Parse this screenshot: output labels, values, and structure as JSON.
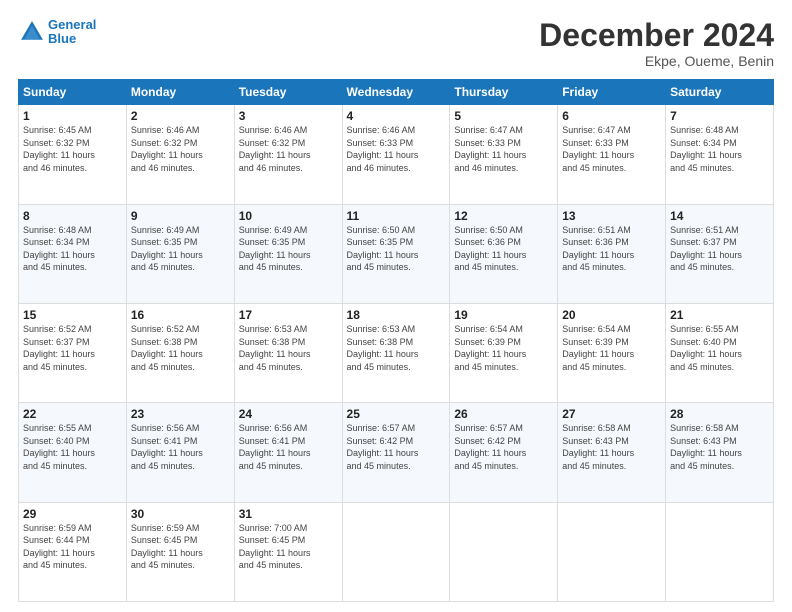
{
  "logo": {
    "line1": "General",
    "line2": "Blue"
  },
  "title": "December 2024",
  "subtitle": "Ekpe, Oueme, Benin",
  "weekdays": [
    "Sunday",
    "Monday",
    "Tuesday",
    "Wednesday",
    "Thursday",
    "Friday",
    "Saturday"
  ],
  "weeks": [
    [
      {
        "day": "1",
        "sunrise": "6:45 AM",
        "sunset": "6:32 PM",
        "daylight": "11 hours and 46 minutes."
      },
      {
        "day": "2",
        "sunrise": "6:46 AM",
        "sunset": "6:32 PM",
        "daylight": "11 hours and 46 minutes."
      },
      {
        "day": "3",
        "sunrise": "6:46 AM",
        "sunset": "6:32 PM",
        "daylight": "11 hours and 46 minutes."
      },
      {
        "day": "4",
        "sunrise": "6:46 AM",
        "sunset": "6:33 PM",
        "daylight": "11 hours and 46 minutes."
      },
      {
        "day": "5",
        "sunrise": "6:47 AM",
        "sunset": "6:33 PM",
        "daylight": "11 hours and 46 minutes."
      },
      {
        "day": "6",
        "sunrise": "6:47 AM",
        "sunset": "6:33 PM",
        "daylight": "11 hours and 45 minutes."
      },
      {
        "day": "7",
        "sunrise": "6:48 AM",
        "sunset": "6:34 PM",
        "daylight": "11 hours and 45 minutes."
      }
    ],
    [
      {
        "day": "8",
        "sunrise": "6:48 AM",
        "sunset": "6:34 PM",
        "daylight": "11 hours and 45 minutes."
      },
      {
        "day": "9",
        "sunrise": "6:49 AM",
        "sunset": "6:35 PM",
        "daylight": "11 hours and 45 minutes."
      },
      {
        "day": "10",
        "sunrise": "6:49 AM",
        "sunset": "6:35 PM",
        "daylight": "11 hours and 45 minutes."
      },
      {
        "day": "11",
        "sunrise": "6:50 AM",
        "sunset": "6:35 PM",
        "daylight": "11 hours and 45 minutes."
      },
      {
        "day": "12",
        "sunrise": "6:50 AM",
        "sunset": "6:36 PM",
        "daylight": "11 hours and 45 minutes."
      },
      {
        "day": "13",
        "sunrise": "6:51 AM",
        "sunset": "6:36 PM",
        "daylight": "11 hours and 45 minutes."
      },
      {
        "day": "14",
        "sunrise": "6:51 AM",
        "sunset": "6:37 PM",
        "daylight": "11 hours and 45 minutes."
      }
    ],
    [
      {
        "day": "15",
        "sunrise": "6:52 AM",
        "sunset": "6:37 PM",
        "daylight": "11 hours and 45 minutes."
      },
      {
        "day": "16",
        "sunrise": "6:52 AM",
        "sunset": "6:38 PM",
        "daylight": "11 hours and 45 minutes."
      },
      {
        "day": "17",
        "sunrise": "6:53 AM",
        "sunset": "6:38 PM",
        "daylight": "11 hours and 45 minutes."
      },
      {
        "day": "18",
        "sunrise": "6:53 AM",
        "sunset": "6:38 PM",
        "daylight": "11 hours and 45 minutes."
      },
      {
        "day": "19",
        "sunrise": "6:54 AM",
        "sunset": "6:39 PM",
        "daylight": "11 hours and 45 minutes."
      },
      {
        "day": "20",
        "sunrise": "6:54 AM",
        "sunset": "6:39 PM",
        "daylight": "11 hours and 45 minutes."
      },
      {
        "day": "21",
        "sunrise": "6:55 AM",
        "sunset": "6:40 PM",
        "daylight": "11 hours and 45 minutes."
      }
    ],
    [
      {
        "day": "22",
        "sunrise": "6:55 AM",
        "sunset": "6:40 PM",
        "daylight": "11 hours and 45 minutes."
      },
      {
        "day": "23",
        "sunrise": "6:56 AM",
        "sunset": "6:41 PM",
        "daylight": "11 hours and 45 minutes."
      },
      {
        "day": "24",
        "sunrise": "6:56 AM",
        "sunset": "6:41 PM",
        "daylight": "11 hours and 45 minutes."
      },
      {
        "day": "25",
        "sunrise": "6:57 AM",
        "sunset": "6:42 PM",
        "daylight": "11 hours and 45 minutes."
      },
      {
        "day": "26",
        "sunrise": "6:57 AM",
        "sunset": "6:42 PM",
        "daylight": "11 hours and 45 minutes."
      },
      {
        "day": "27",
        "sunrise": "6:58 AM",
        "sunset": "6:43 PM",
        "daylight": "11 hours and 45 minutes."
      },
      {
        "day": "28",
        "sunrise": "6:58 AM",
        "sunset": "6:43 PM",
        "daylight": "11 hours and 45 minutes."
      }
    ],
    [
      {
        "day": "29",
        "sunrise": "6:59 AM",
        "sunset": "6:44 PM",
        "daylight": "11 hours and 45 minutes."
      },
      {
        "day": "30",
        "sunrise": "6:59 AM",
        "sunset": "6:45 PM",
        "daylight": "11 hours and 45 minutes."
      },
      {
        "day": "31",
        "sunrise": "7:00 AM",
        "sunset": "6:45 PM",
        "daylight": "11 hours and 45 minutes."
      },
      null,
      null,
      null,
      null
    ]
  ]
}
